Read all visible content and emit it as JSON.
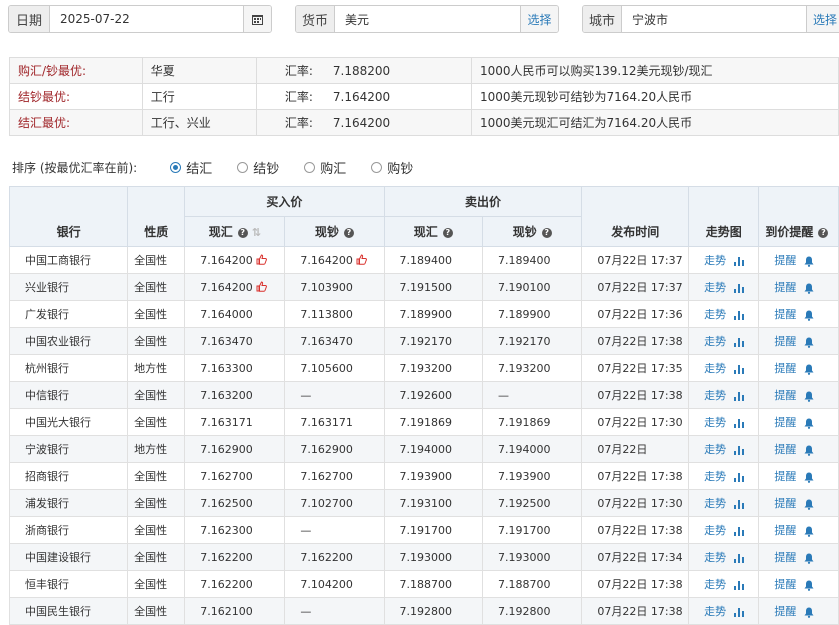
{
  "filters": {
    "date": {
      "label": "日期",
      "value": "2025-07-22"
    },
    "currency": {
      "label": "货币",
      "value": "美元",
      "button": "选择"
    },
    "city": {
      "label": "城市",
      "value": "宁波市",
      "button": "选择"
    }
  },
  "best": [
    {
      "label": "购汇/钞最优:",
      "banks": "华夏",
      "rate_label": "汇率:",
      "rate": "7.188200",
      "note": "1000人民币可以购买139.12美元现钞/现汇"
    },
    {
      "label": "结钞最优:",
      "banks": "工行",
      "rate_label": "汇率:",
      "rate": "7.164200",
      "note": "1000美元现钞可结钞为7164.20人民币"
    },
    {
      "label": "结汇最优:",
      "banks": "工行、兴业",
      "rate_label": "汇率:",
      "rate": "7.164200",
      "note": "1000美元现汇可结汇为7164.20人民币"
    }
  ],
  "sort": {
    "label": "排序 (按最优汇率在前):",
    "options": [
      "结汇",
      "结钞",
      "购汇",
      "购钞"
    ],
    "selected": "结汇"
  },
  "table": {
    "headers": {
      "bank": "银行",
      "type": "性质",
      "buy": "买入价",
      "sell": "卖出价",
      "buy_spot": "现汇",
      "buy_cash": "现钞",
      "sell_spot": "现汇",
      "sell_cash": "现钞",
      "time": "发布时间",
      "trend": "走势图",
      "alert": "到价提醒"
    },
    "rows": [
      {
        "bank": "中国工商银行",
        "type": "全国性",
        "buy_spot": "7.164200",
        "buy_cash": "7.164200",
        "sell_spot": "7.189400",
        "sell_cash": "7.189400",
        "time": "07月22日 17:37",
        "trend": "走势",
        "alert": "提醒"
      },
      {
        "bank": "兴业银行",
        "type": "全国性",
        "buy_spot": "7.164200",
        "buy_cash": "7.103900",
        "sell_spot": "7.191500",
        "sell_cash": "7.190100",
        "time": "07月22日 17:37",
        "trend": "走势",
        "alert": "提醒"
      },
      {
        "bank": "广发银行",
        "type": "全国性",
        "buy_spot": "7.164000",
        "buy_cash": "7.113800",
        "sell_spot": "7.189900",
        "sell_cash": "7.189900",
        "time": "07月22日 17:36",
        "trend": "走势",
        "alert": "提醒"
      },
      {
        "bank": "中国农业银行",
        "type": "全国性",
        "buy_spot": "7.163470",
        "buy_cash": "7.163470",
        "sell_spot": "7.192170",
        "sell_cash": "7.192170",
        "time": "07月22日 17:38",
        "trend": "走势",
        "alert": "提醒"
      },
      {
        "bank": "杭州银行",
        "type": "地方性",
        "buy_spot": "7.163300",
        "buy_cash": "7.105600",
        "sell_spot": "7.193200",
        "sell_cash": "7.193200",
        "time": "07月22日 17:35",
        "trend": "走势",
        "alert": "提醒"
      },
      {
        "bank": "中信银行",
        "type": "全国性",
        "buy_spot": "7.163200",
        "buy_cash": "—",
        "sell_spot": "7.192600",
        "sell_cash": "—",
        "time": "07月22日 17:38",
        "trend": "走势",
        "alert": "提醒"
      },
      {
        "bank": "中国光大银行",
        "type": "全国性",
        "buy_spot": "7.163171",
        "buy_cash": "7.163171",
        "sell_spot": "7.191869",
        "sell_cash": "7.191869",
        "time": "07月22日 17:30",
        "trend": "走势",
        "alert": "提醒"
      },
      {
        "bank": "宁波银行",
        "type": "地方性",
        "buy_spot": "7.162900",
        "buy_cash": "7.162900",
        "sell_spot": "7.194000",
        "sell_cash": "7.194000",
        "time": "07月22日",
        "trend": "走势",
        "alert": "提醒"
      },
      {
        "bank": "招商银行",
        "type": "全国性",
        "buy_spot": "7.162700",
        "buy_cash": "7.162700",
        "sell_spot": "7.193900",
        "sell_cash": "7.193900",
        "time": "07月22日 17:38",
        "trend": "走势",
        "alert": "提醒"
      },
      {
        "bank": "浦发银行",
        "type": "全国性",
        "buy_spot": "7.162500",
        "buy_cash": "7.102700",
        "sell_spot": "7.193100",
        "sell_cash": "7.192500",
        "time": "07月22日 17:30",
        "trend": "走势",
        "alert": "提醒"
      },
      {
        "bank": "浙商银行",
        "type": "全国性",
        "buy_spot": "7.162300",
        "buy_cash": "—",
        "sell_spot": "7.191700",
        "sell_cash": "7.191700",
        "time": "07月22日 17:38",
        "trend": "走势",
        "alert": "提醒"
      },
      {
        "bank": "中国建设银行",
        "type": "全国性",
        "buy_spot": "7.162200",
        "buy_cash": "7.162200",
        "sell_spot": "7.193000",
        "sell_cash": "7.193000",
        "time": "07月22日 17:34",
        "trend": "走势",
        "alert": "提醒"
      },
      {
        "bank": "恒丰银行",
        "type": "全国性",
        "buy_spot": "7.162200",
        "buy_cash": "7.104200",
        "sell_spot": "7.188700",
        "sell_cash": "7.188700",
        "time": "07月22日 17:38",
        "trend": "走势",
        "alert": "提醒"
      },
      {
        "bank": "中国民生银行",
        "type": "全国性",
        "buy_spot": "7.162100",
        "buy_cash": "—",
        "sell_spot": "7.192800",
        "sell_cash": "7.192800",
        "time": "07月22日 17:38",
        "trend": "走势",
        "alert": "提醒"
      }
    ]
  }
}
